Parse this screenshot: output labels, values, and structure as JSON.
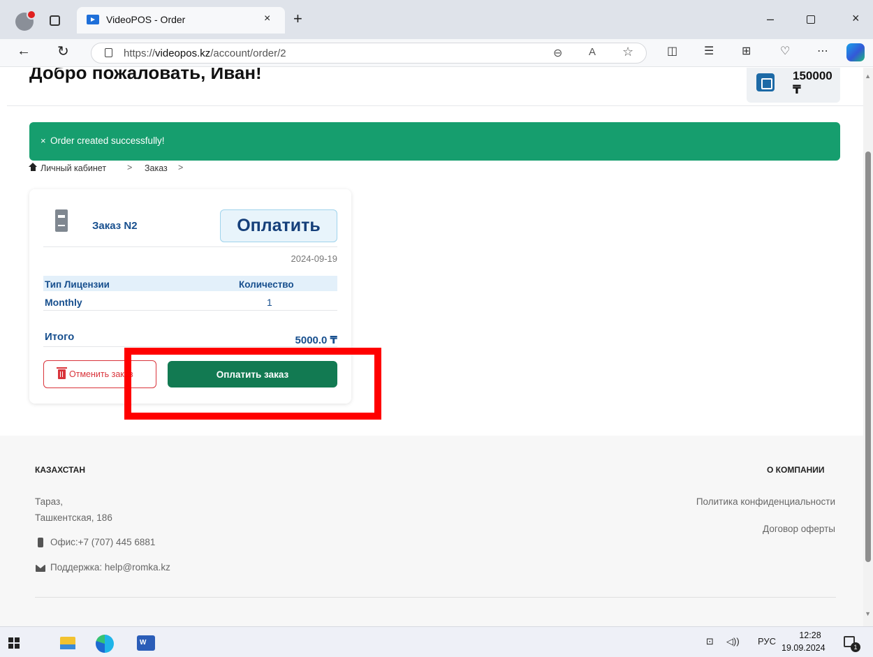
{
  "browser": {
    "tab_title": "VideoPOS - Order",
    "tab_close": "×",
    "new_tab": "+",
    "url_prefix": "https://",
    "url_host": "videopos.kz",
    "url_path": "/account/order/2",
    "window_min": "–",
    "window_close": "×"
  },
  "header": {
    "welcome": "Добро пожаловать, Иван!",
    "balance": "150000 ₸"
  },
  "alert": {
    "close": "×",
    "message": "Order created successfully!"
  },
  "breadcrumb": {
    "items": [
      "Личный кабинет",
      "Заказ"
    ],
    "separator": ">"
  },
  "order": {
    "title": "Заказ N2",
    "pay_top_label": "Оплатить",
    "date": "2024-09-19",
    "table": {
      "headers": [
        "Тип Лицензии",
        "Количество"
      ],
      "rows": [
        [
          "Monthly",
          "1"
        ]
      ]
    },
    "total_label": "Итого",
    "total_value": "5000.0 ₸",
    "cancel_label": "Отменить заказ",
    "pay_label": "Оплатить заказ"
  },
  "footer": {
    "left_heading": "КАЗАХСТАН",
    "city": "Тараз,",
    "street": "Ташкентская, 186",
    "phone": "Офис:+7 (707) 445 6881",
    "support": "Поддержка: help@romka.kz",
    "right_heading": "О КОМПАНИИ",
    "privacy": "Политика конфиденциальности",
    "offer": "Договор оферты"
  },
  "taskbar": {
    "language": "РУС",
    "time": "12:28",
    "date": "19.09.2024",
    "notifications": "1"
  },
  "colors": {
    "accent_green": "#169e6e",
    "button_green": "#127a52",
    "primary_blue": "#174f8e",
    "danger_red": "#d9343b",
    "highlight_red": "#ff0000"
  }
}
